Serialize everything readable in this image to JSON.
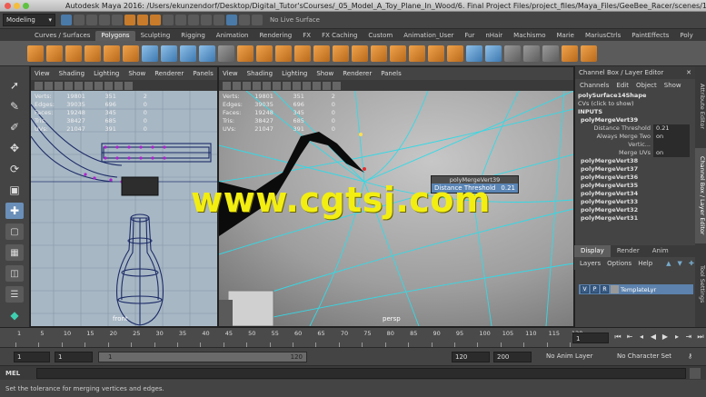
{
  "window": {
    "title": "Autodesk Maya 2016: /Users/ekunzendorf/Desktop/Digital_Tutor'sCourses/_05_Model_A_Toy_Plane_In_Wood/6. Final Project Files/project_files/Maya_Files/GeeBee_Racer/scenes/15..."
  },
  "statusline": {
    "mode": "Modeling",
    "live_surface": "No Live Surface"
  },
  "shelf_tabs": [
    "Curves / Surfaces",
    "Polygons",
    "Sculpting",
    "Rigging",
    "Animation",
    "Rendering",
    "FX",
    "FX Caching",
    "Custom",
    "Animation_User",
    "Fur",
    "nHair",
    "Machismo",
    "Marie",
    "MariusCtrls",
    "PaintEffects",
    "Poly"
  ],
  "active_shelf_tab": "Polygons",
  "panel_menu": [
    "View",
    "Shading",
    "Lighting",
    "Show",
    "Renderer",
    "Panels"
  ],
  "left_view": {
    "camera": "front",
    "hud": [
      {
        "label": "Verts:",
        "v1": "19801",
        "v2": "351",
        "v3": "2"
      },
      {
        "label": "Edges:",
        "v1": "39035",
        "v2": "696",
        "v3": "0"
      },
      {
        "label": "Faces:",
        "v1": "19248",
        "v2": "345",
        "v3": "0"
      },
      {
        "label": "Tris:",
        "v1": "38427",
        "v2": "685",
        "v3": "0"
      },
      {
        "label": "UVs:",
        "v1": "21047",
        "v2": "391",
        "v3": "0"
      }
    ]
  },
  "right_view": {
    "camera": "persp",
    "hud": [
      {
        "label": "Verts:",
        "v1": "19801",
        "v2": "351",
        "v3": "2"
      },
      {
        "label": "Edges:",
        "v1": "39035",
        "v2": "696",
        "v3": "0"
      },
      {
        "label": "Faces:",
        "v1": "19248",
        "v2": "345",
        "v3": "0"
      },
      {
        "label": "Tris:",
        "v1": "38427",
        "v2": "685",
        "v3": "0"
      },
      {
        "label": "UVs:",
        "v1": "21047",
        "v2": "391",
        "v3": "0"
      }
    ]
  },
  "popup": {
    "title": "polyMergeVert39",
    "attr": "Distance Threshold",
    "value": "0.21"
  },
  "watermark": "www.cgtsj.com",
  "channel_box": {
    "title": "Channel Box / Layer Editor",
    "menu": [
      "Channels",
      "Edit",
      "Object",
      "Show"
    ],
    "shape": "polySurface14Shape",
    "cvs": "CVs (click to show)",
    "inputs_label": "INPUTS",
    "current_node": "polyMergeVert39",
    "attrs": [
      {
        "label": "Distance Threshold",
        "value": "0.21"
      },
      {
        "label": "Always Merge Two Vertic...",
        "value": "on"
      },
      {
        "label": "Merge UVs",
        "value": "on"
      }
    ],
    "history": [
      "polyMergeVert38",
      "polyMergeVert37",
      "polyMergeVert36",
      "polyMergeVert35",
      "polyMergeVert34",
      "polyMergeVert33",
      "polyMergeVert32",
      "polyMergeVert31"
    ]
  },
  "layer_editor": {
    "tabs": [
      "Display",
      "Render",
      "Anim"
    ],
    "active_tab": "Display",
    "menu": [
      "Layers",
      "Options",
      "Help"
    ],
    "layer": {
      "v": "V",
      "p": "P",
      "r": "R",
      "name": "TemplateLyr"
    }
  },
  "side_tabs": [
    "Attribute Editor",
    "Channel Box / Layer Editor",
    "Tool Settings"
  ],
  "timeline": {
    "ticks": [
      "1",
      "5",
      "10",
      "15",
      "20",
      "25",
      "30",
      "35",
      "40",
      "45",
      "50",
      "55",
      "60",
      "65",
      "70",
      "75",
      "80",
      "85",
      "90",
      "95",
      "100",
      "105",
      "110",
      "115",
      "120"
    ],
    "current_frame": "1"
  },
  "range": {
    "start_field": "1",
    "start_field2": "1",
    "bar_start": "1",
    "bar_end": "120",
    "end_field": "120",
    "end_field2": "200",
    "anim_layer": "No Anim Layer",
    "char_set": "No Character Set"
  },
  "cmdline": {
    "label": "MEL"
  },
  "help_line": "Set the tolerance for merging vertices and edges."
}
